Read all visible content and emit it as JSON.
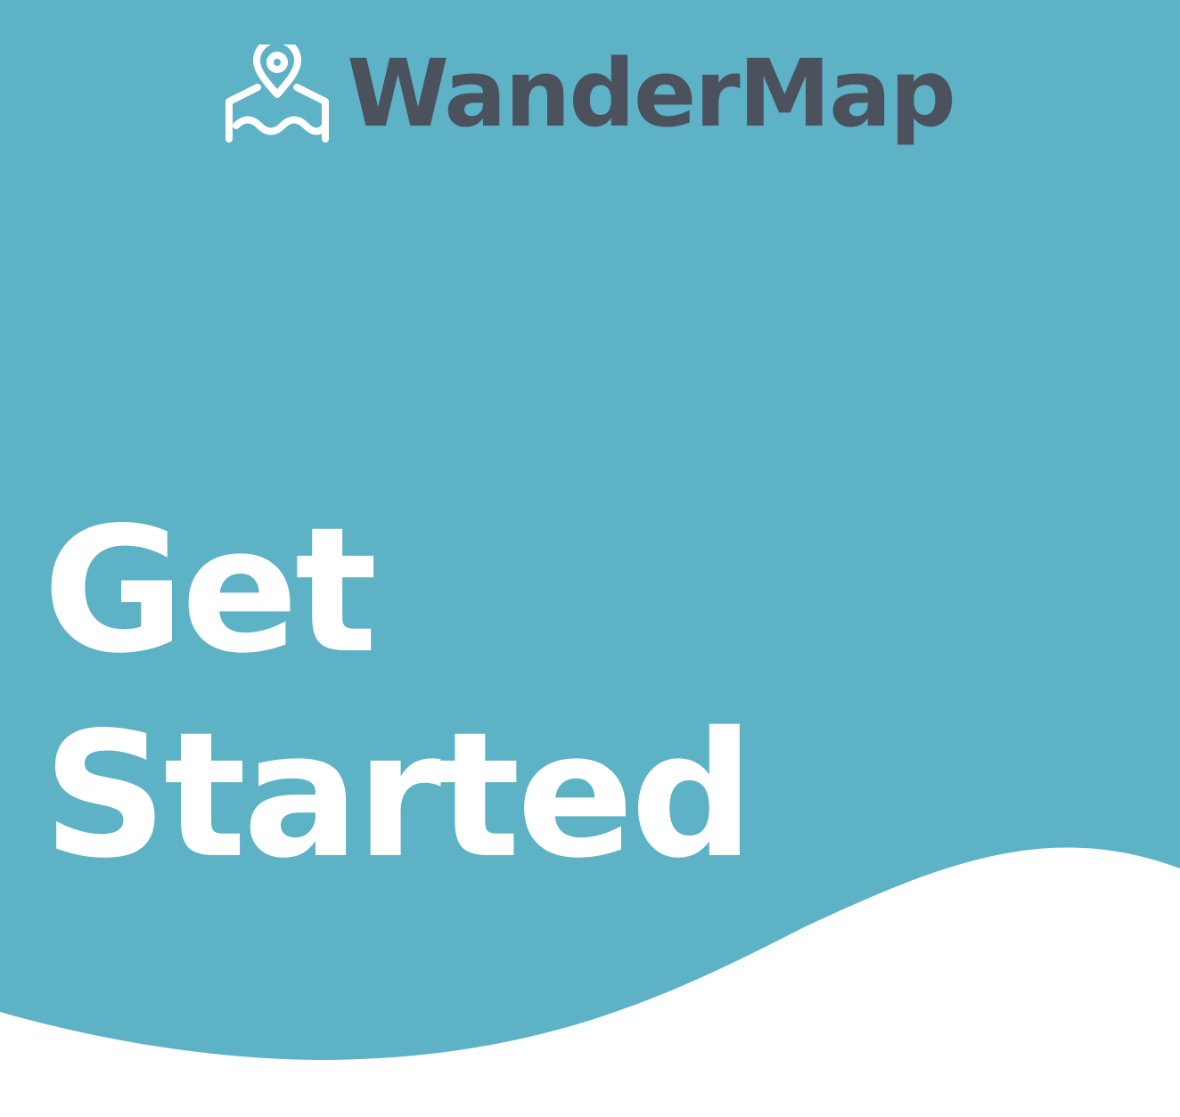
{
  "app": {
    "name": "WanderMap",
    "logo_icon": "map-pin-icon"
  },
  "hero": {
    "line1": "Get",
    "line2": "Started"
  },
  "theme": {
    "background": "#5db2c6",
    "brand_text": "#4b515d",
    "headline_text": "#ffffff",
    "wave": "#ffffff"
  }
}
